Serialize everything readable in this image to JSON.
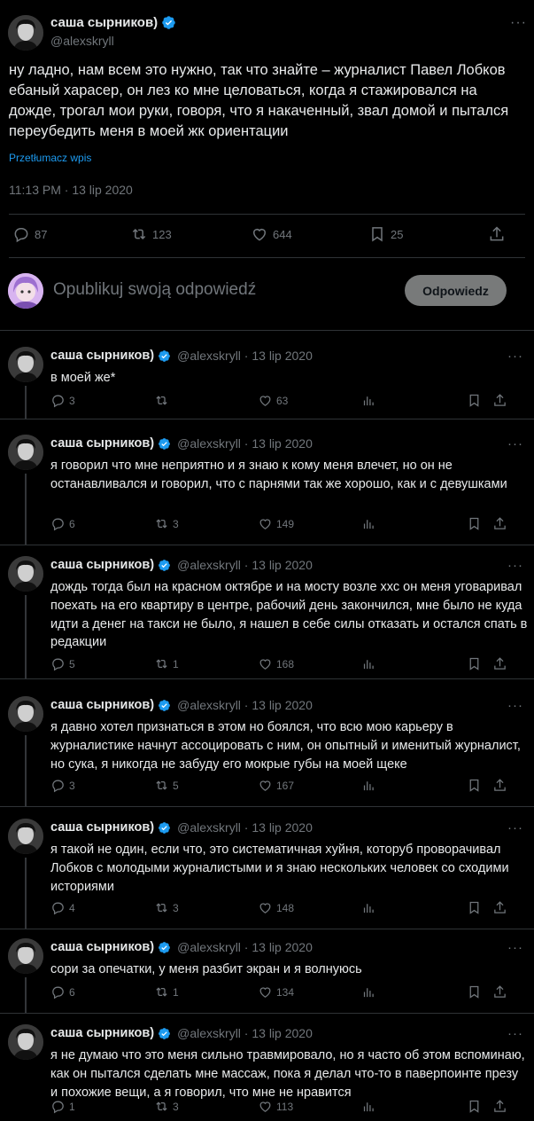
{
  "main_tweet": {
    "author_name": "саша сырников)",
    "handle": "@alexskryll",
    "more": "···",
    "text": "ну ладно, нам всем это нужно, так что знайте – журналист Павел Лобков ебаный харасер, он лез ко мне целоваться, когда я стажировался на дожде, трогал мои руки, говоря, что я накаченный, звал домой и пытался переубедить меня в моей жк ориентации",
    "translate_label": "Przetłumacz wpis",
    "timestamp": "11:13 PM · 13 lip 2020",
    "replies": "87",
    "retweets": "123",
    "likes": "644",
    "bookmarks": "25"
  },
  "composer": {
    "placeholder": "Opublikuj swoją odpowiedź",
    "button_label": "Odpowiedz"
  },
  "thread": [
    {
      "author_name": "саша сырников)",
      "meta": "@alexskryll · 13 lip 2020",
      "text": "в моей же*",
      "replies": "3",
      "retweets": "",
      "likes": "63"
    },
    {
      "author_name": "саша сырников)",
      "meta": "@alexskryll · 13 lip 2020",
      "text": "я говорил что мне неприятно и я знаю к кому меня влечет, но он не останавливался и говорил, что с парнями так же хорошо, как и с девушками",
      "replies": "6",
      "retweets": "3",
      "likes": "149"
    },
    {
      "author_name": "саша сырников)",
      "meta": "@alexskryll · 13 lip 2020",
      "text": "дождь тогда был на красном октябре и на мосту возле ххс он меня уговаривал поехать на его квартиру в центре, рабочий день закончился, мне было не куда идти а денег на такси не было, я нашел в себе силы отказать и остался спать в редакции",
      "replies": "5",
      "retweets": "1",
      "likes": "168"
    },
    {
      "author_name": "саша сырников)",
      "meta": "@alexskryll · 13 lip 2020",
      "text": "я давно хотел признаться в этом но боялся, что всю мою карьеру в журналистике начнут ассоцировать с ним, он опытный и именитый журналист, но сука, я никогда не забуду его мокрые губы на моей щеке",
      "replies": "3",
      "retweets": "5",
      "likes": "167"
    },
    {
      "author_name": "саша сырников)",
      "meta": "@alexskryll · 13 lip 2020",
      "text": "я такой не один, если что, это систематичная хуйня, которуб проворачивал Лобков с молодыми журналистыми и я знаю нескольких человек со сходими историями",
      "replies": "4",
      "retweets": "3",
      "likes": "148"
    },
    {
      "author_name": "саша сырников)",
      "meta": "@alexskryll · 13 lip 2020",
      "text": "сори за опечатки, у меня разбит экран и я волнуюсь",
      "replies": "6",
      "retweets": "1",
      "likes": "134"
    },
    {
      "author_name": "саша сырников)",
      "meta": "@alexskryll · 13 lip 2020",
      "text": "я не думаю что это меня сильно травмировало, но я часто об этом вспоминаю, как он пытался сделать мне массаж, пока я делал что-то в паверпоинте презу и похожие вещи, а я говорил, что мне не нравится",
      "replies": "1",
      "retweets": "3",
      "likes": "113"
    }
  ],
  "colors": {
    "background": "#000000",
    "text": "#e7e9ea",
    "muted": "#71767b",
    "accent": "#1d9bf0",
    "divider": "#2f3336",
    "reply_button": "#787a7a"
  },
  "icons": [
    "verified-badge-icon",
    "reply-icon",
    "retweet-icon",
    "like-icon",
    "bookmark-icon",
    "share-icon",
    "views-icon",
    "more-icon"
  ]
}
